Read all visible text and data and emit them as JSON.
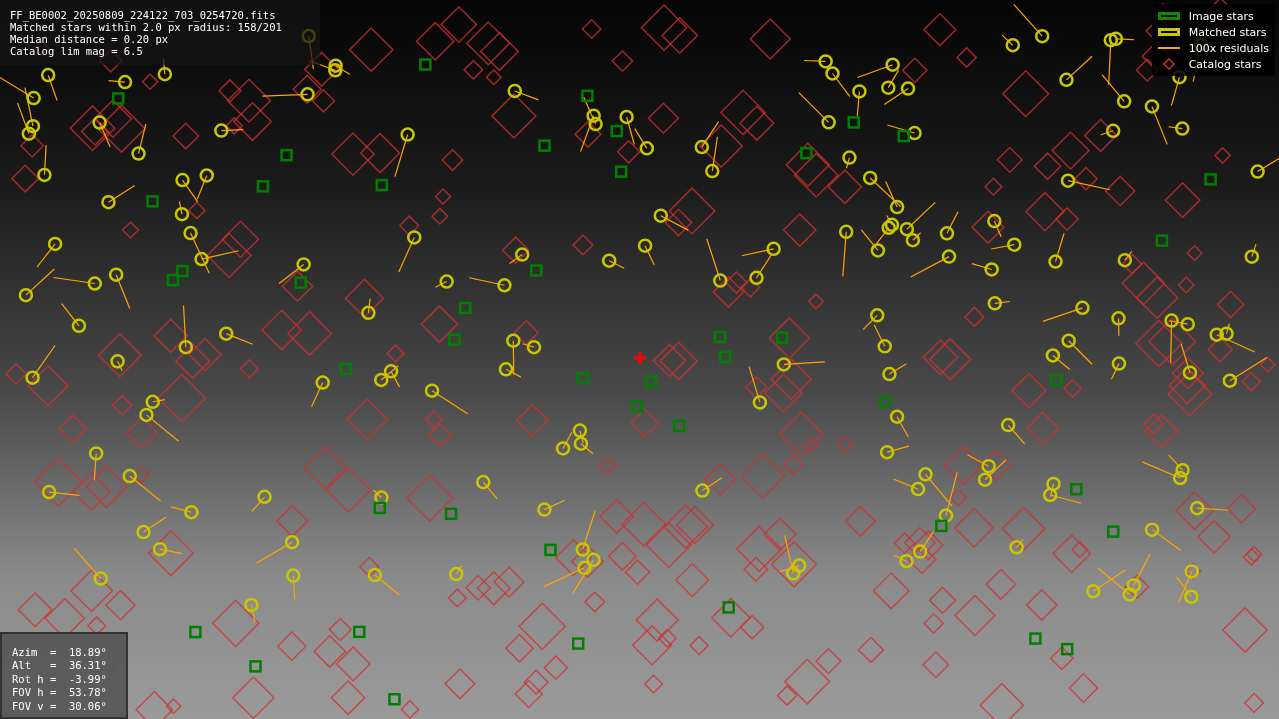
{
  "info_panel": {
    "lines": [
      "FF_BE0002_20250809_224122_703_0254720.fits",
      "Matched stars within 2.0 px radius: 158/201",
      "Median distance = 0.20 px",
      "Catalog lim mag = 6.5"
    ]
  },
  "legend": {
    "items": [
      {
        "kind": "image",
        "label": "Image stars"
      },
      {
        "kind": "matched",
        "label": "Matched stars"
      },
      {
        "kind": "residual",
        "label": "100x residuals"
      },
      {
        "kind": "catalog",
        "label": "Catalog stars"
      }
    ]
  },
  "pointing_panel": {
    "lines": [
      "Azim  =  18.89°",
      "Alt   =  36.31°",
      "Rot h =  -3.99°",
      "FOV h =  53.78°",
      "FOV v =  30.06°"
    ]
  }
}
